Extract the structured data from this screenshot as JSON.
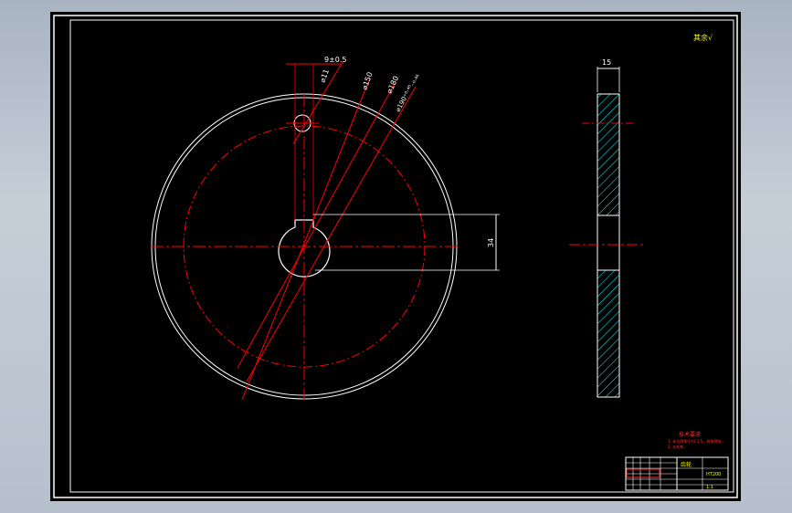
{
  "drawing": {
    "roughness_symbol": "其余√",
    "dimensions": {
      "keyway_offset": "9±0.5",
      "hole_dia": "⌀11",
      "dia_150": "⌀150",
      "dia_180": "⌀180",
      "dia_190": "⌀190⁺⁰·⁴⁶₋₀.₄₆",
      "keyway_depth": "34",
      "thickness": "15"
    },
    "tech_notes": {
      "title": "技术要求",
      "line1": "1. 未注倒角均为C1.5，锐角倒钝。",
      "line2": "2. 去毛刺。"
    },
    "title_block": {
      "part_name": "齿轮",
      "material": "HT200",
      "scale": "1:1"
    }
  },
  "colors": {
    "background": "#000000",
    "outline": "#ffffff",
    "centerline": "#ff0000",
    "hatch": "#00ffff",
    "accent": "#ffff00",
    "frame_outer": "#ffffff"
  }
}
